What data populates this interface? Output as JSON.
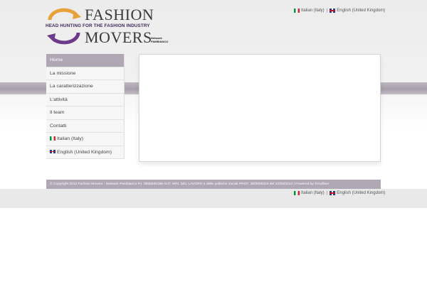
{
  "logo": {
    "word1": "FASHION",
    "tagline": "HEAD HUNTING FOR THE FASHION INDUSTRY",
    "word2": "MOVERS",
    "network_line1": "Network",
    "network_line2": "PAMBIANCO",
    "colors": {
      "orange": "#e8a23a",
      "purple": "#6b3a8a"
    }
  },
  "languages": {
    "italian": "Italian (Italy)",
    "english": "English (United Kingdom)",
    "separator": "|"
  },
  "nav": {
    "items": [
      {
        "label": "Home"
      },
      {
        "label": "La missione"
      },
      {
        "label": "La caratterizzazione"
      },
      {
        "label": "L'attività"
      },
      {
        "label": "Il team"
      },
      {
        "label": "Contatti"
      },
      {
        "label": "Italian (Italy)"
      },
      {
        "label": "English (United Kingdom)"
      }
    ]
  },
  "footer": {
    "text": "© Copyright 2013 Fashion Movers - Network Pambianco P.I. 0588630159 AUT. MIN. DEL LAVORO e delle politiche sociali PROT. 39/0006323 del 10/05/2013 | Powered by ©Gulliver"
  },
  "theme": {
    "accent": "#b0a7b4",
    "stripe": "#a79fab"
  }
}
